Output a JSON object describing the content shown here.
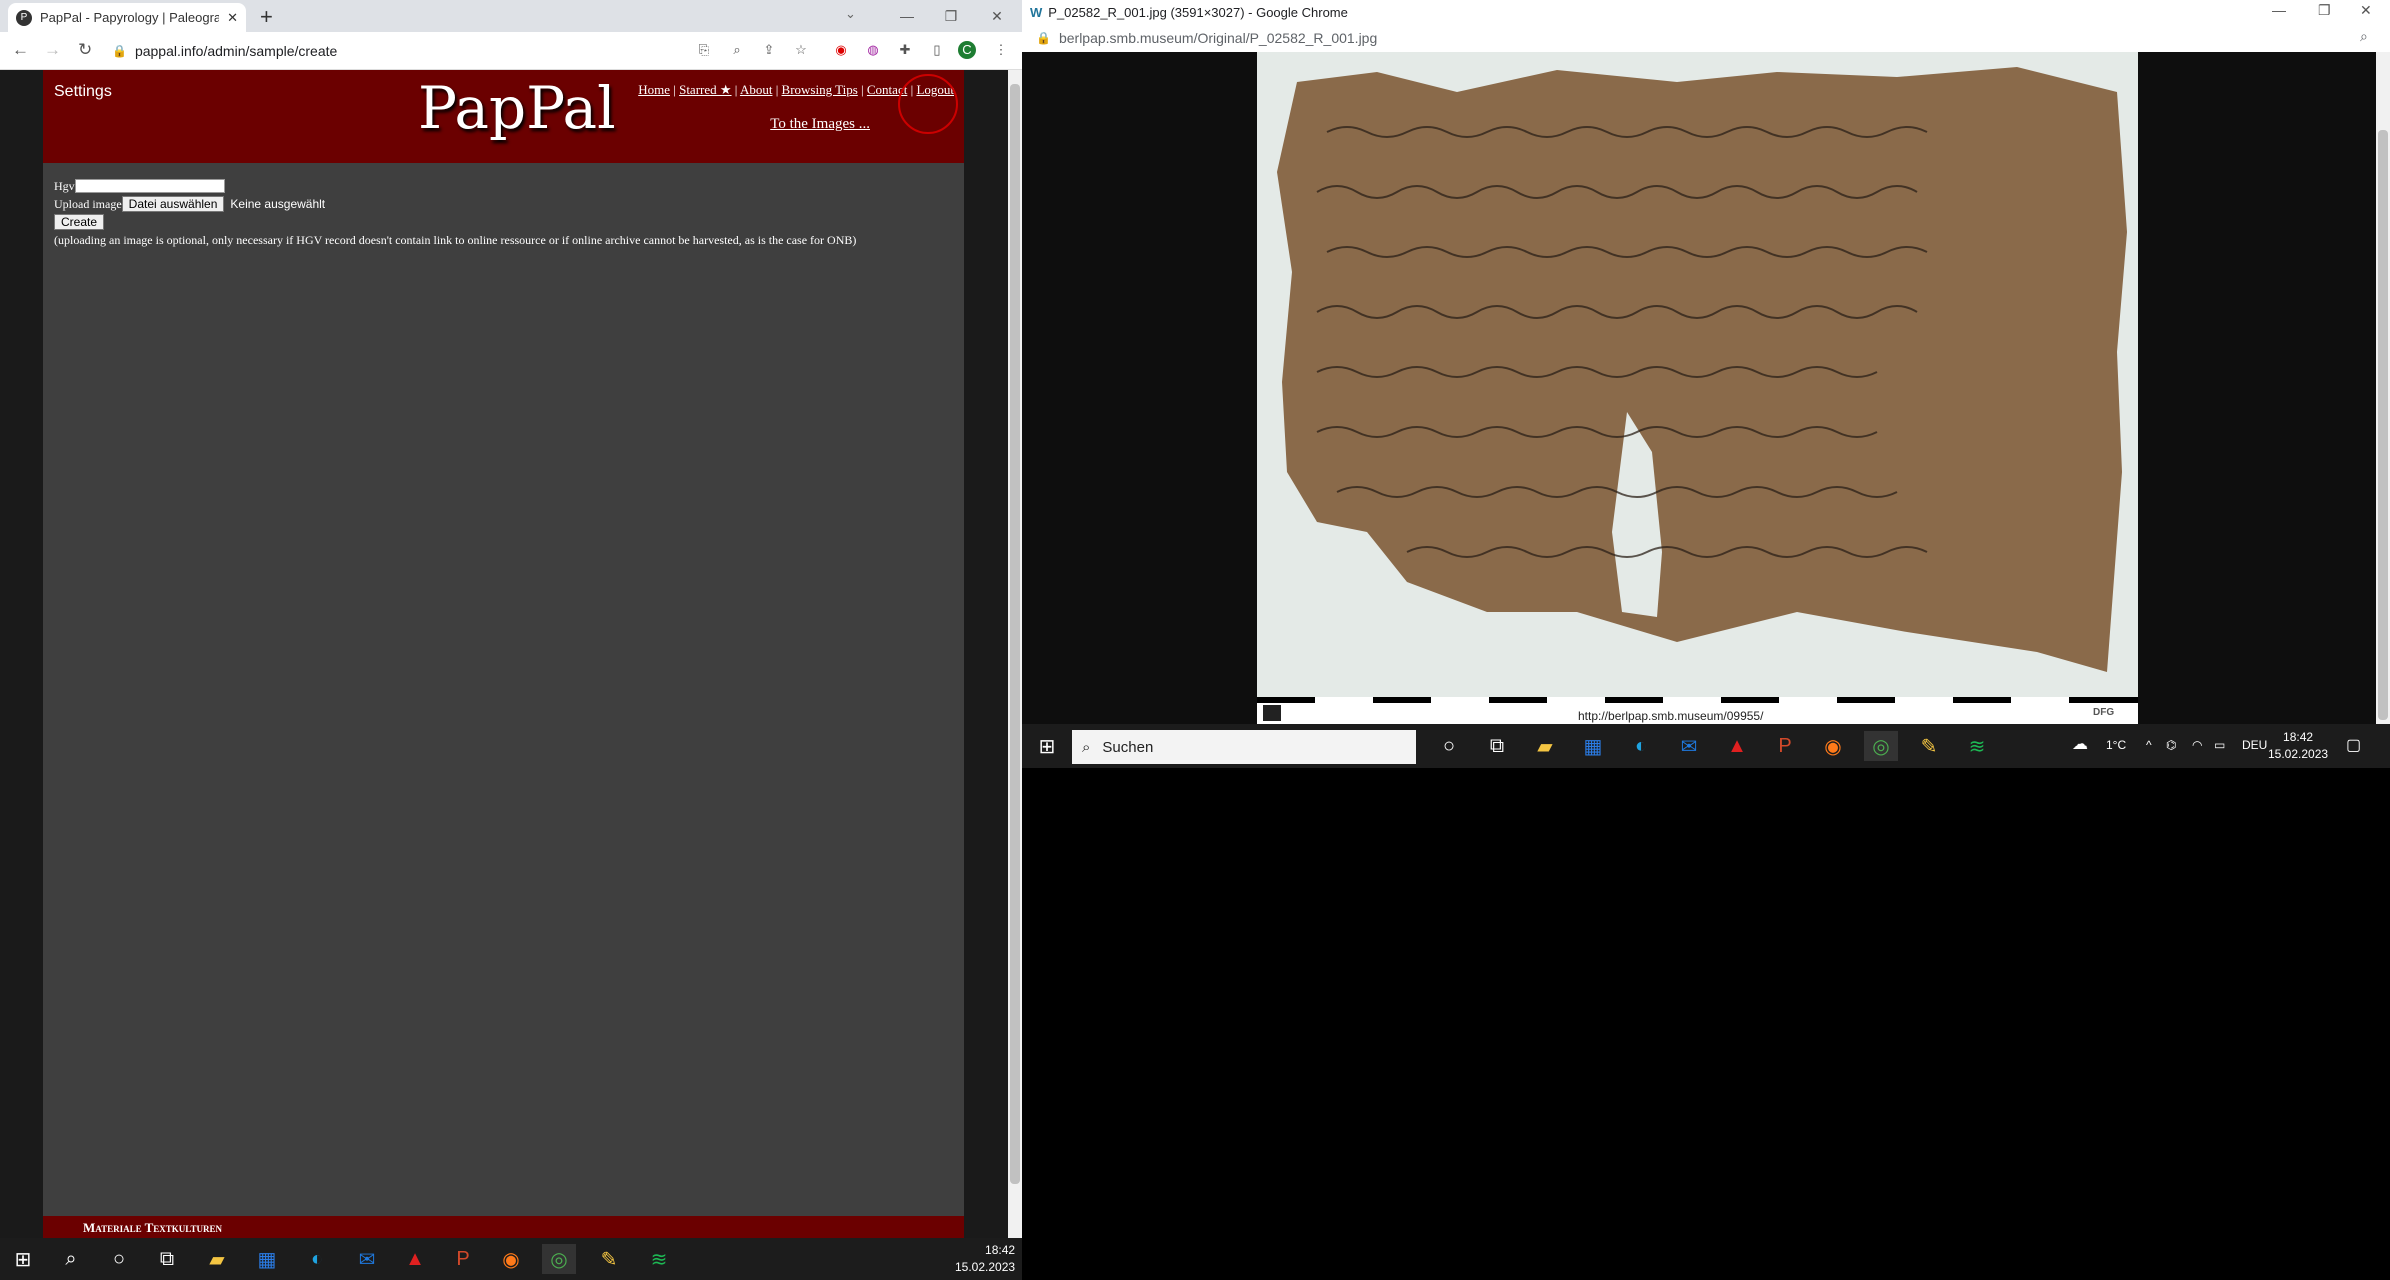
{
  "left_browser": {
    "tab_title": "PapPal - Papyrology | Paleograph",
    "url": "pappal.info/admin/sample/create",
    "page": {
      "settings_label": "Settings",
      "logo": "PapPal",
      "nav_links": [
        "Home",
        "Starred ★",
        "About",
        "Browsing Tips",
        "Contact",
        "Logout"
      ],
      "to_images": "To the Images ...",
      "hgv_label": "Hgv",
      "upload_label": "Upload image",
      "file_button": "Datei auswählen",
      "no_file": "Keine ausgewählt",
      "create_button": "Create",
      "note": "(uploading an image is optional, only necessary if HGV record doesn't contain link to online ressource or if online archive cannot be harvested, as is the case for ONB)",
      "footer_text": "Materiale Textkulturen"
    },
    "clock_time": "18:42",
    "clock_date": "15.02.2023"
  },
  "right_browser": {
    "window_title": "P_02582_R_001.jpg (3591×3027) - Google Chrome",
    "url": "berlpap.smb.museum/Original/P_02582_R_001.jpg",
    "image_caption_url": "http://berlpap.smb.museum/09955/",
    "search_placeholder": "Suchen",
    "temperature": "1°C",
    "language": "DEU",
    "clock_time": "18:42",
    "clock_date": "15.02.2023"
  },
  "colors": {
    "banner": "#6b0000",
    "page_bg": "#3f3f3f",
    "papyrus": "#8a6a4a"
  }
}
